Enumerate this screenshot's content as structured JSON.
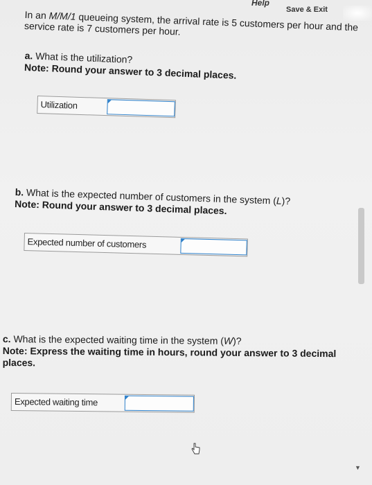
{
  "header": {
    "help_label": "Help",
    "save_exit_label": "Save & Exit"
  },
  "intro": {
    "text_before": "In an ",
    "model": "M/M/1",
    "text_after": " queueing system, the arrival rate is 5 customers per hour and the service rate is 7 customers per hour."
  },
  "questions": [
    {
      "letter": "a.",
      "question": "What is the utilization?",
      "note": "Note: Round your answer to 3 decimal places.",
      "field_label": "Utilization",
      "value": ""
    },
    {
      "letter": "b.",
      "question_before": "What is the expected number of customers in the system (",
      "symbol": "L",
      "question_after": ")?",
      "note": "Note: Round your answer to 3 decimal places.",
      "field_label": "Expected number of customers",
      "value": ""
    },
    {
      "letter": "c.",
      "question_before": "What is the expected waiting time in the system (",
      "symbol": "W",
      "question_after": ")?",
      "note": "Note: Express the waiting time in hours, round your answer to 3 decimal places.",
      "field_label": "Expected waiting time",
      "value": ""
    }
  ],
  "icons": {
    "cursor": "pointer-hand-icon",
    "scroll": "chevron-down-icon"
  }
}
